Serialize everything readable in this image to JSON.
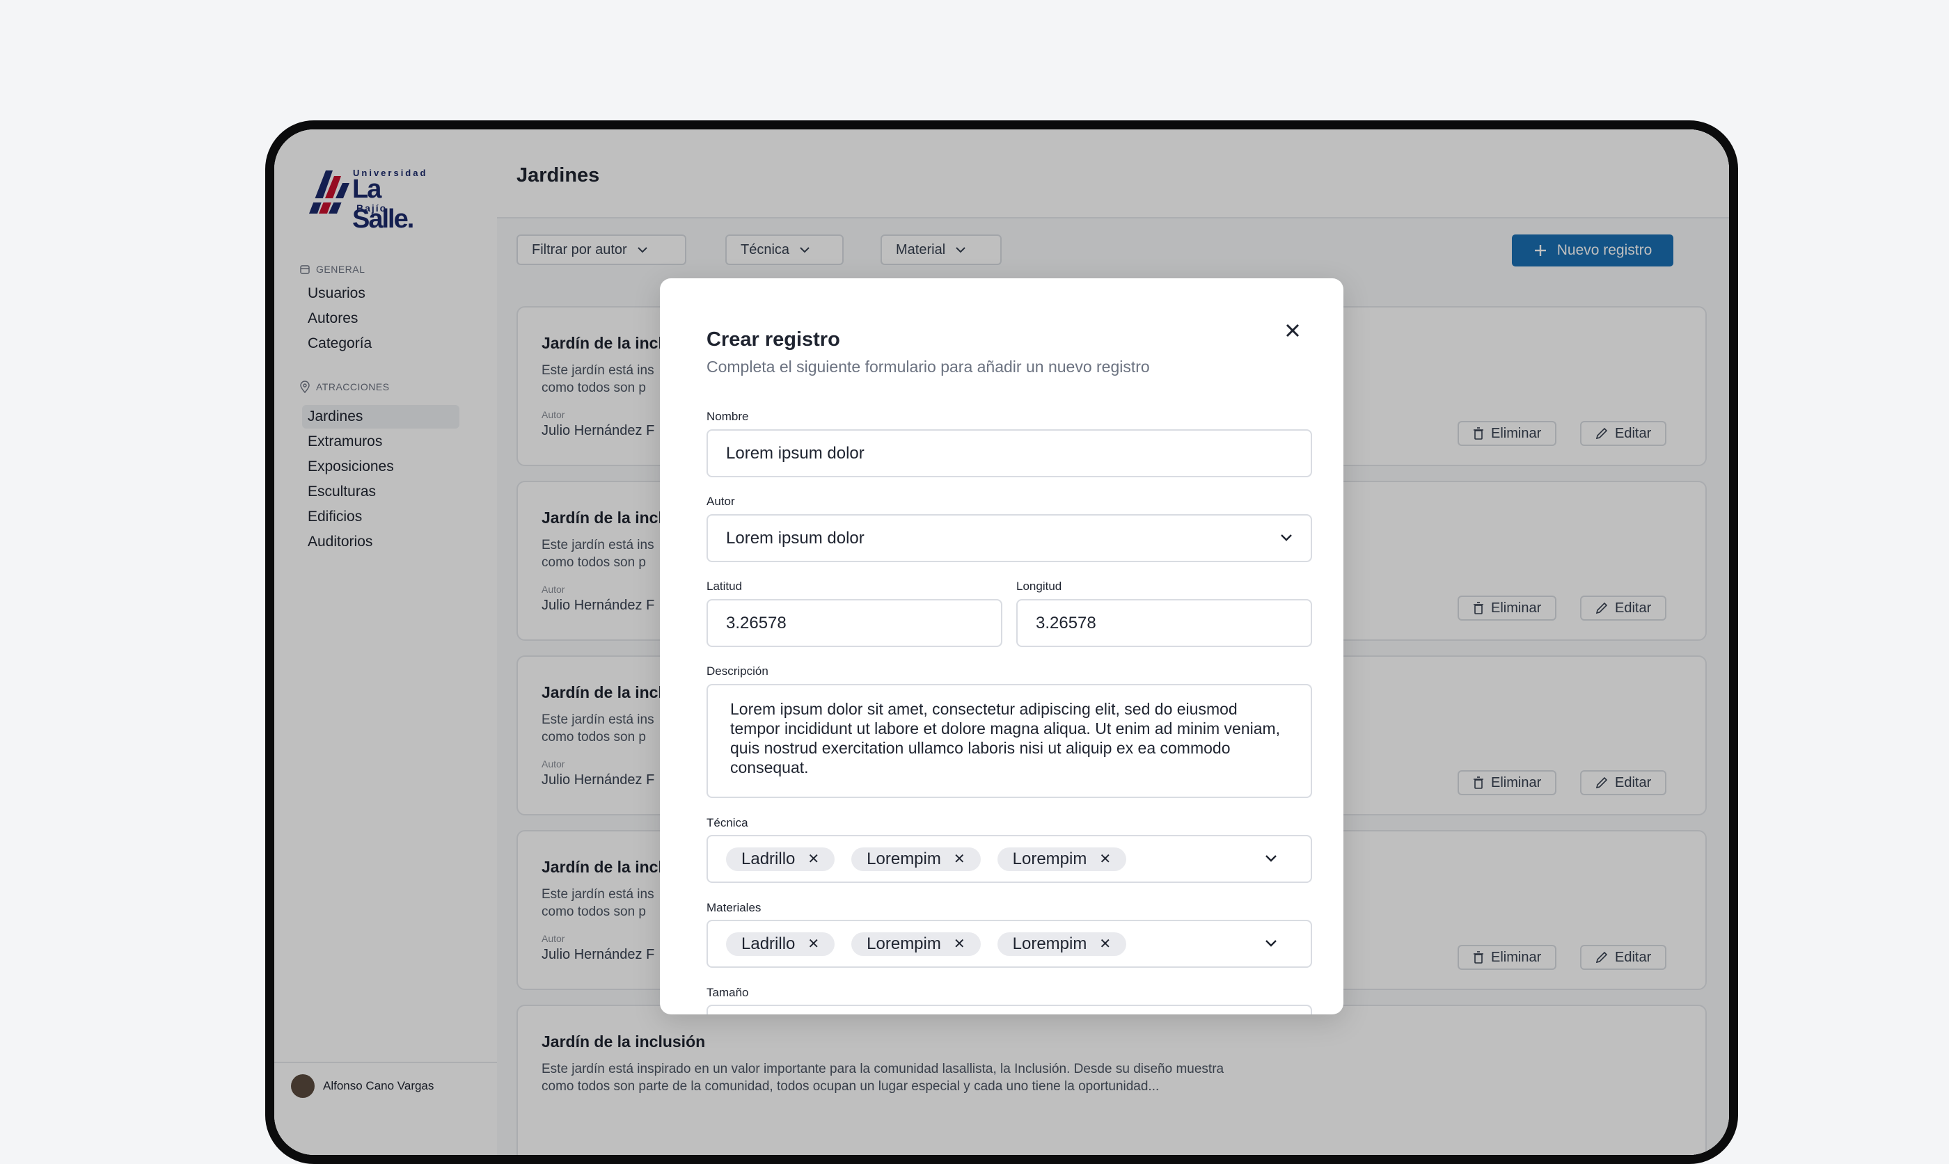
{
  "brand": {
    "top": "Universidad",
    "main": "La Salle.",
    "bottom": "Bajío",
    "colors": {
      "navy": "#1b2a6b",
      "red": "#c8102e"
    }
  },
  "sidebar": {
    "sections": [
      {
        "title": "GENERAL",
        "icon": "calendar-icon",
        "items": [
          "Usuarios",
          "Autores",
          "Categoría"
        ]
      },
      {
        "title": "ATRACCIONES",
        "icon": "map-pin-icon",
        "items": [
          "Jardines",
          "Extramuros",
          "Exposiciones",
          "Esculturas",
          "Edificios",
          "Auditorios"
        ]
      }
    ],
    "active_item": "Jardines",
    "user": {
      "name": "Alfonso Cano Vargas"
    }
  },
  "page": {
    "title": "Jardines",
    "filters": [
      {
        "label": "Filtrar por autor",
        "icon": "chevron-down-icon"
      },
      {
        "label": "Técnica",
        "icon": "chevron-down-icon"
      },
      {
        "label": "Material",
        "icon": "chevron-down-icon"
      }
    ],
    "new_button": {
      "label": "Nuevo registro",
      "icon": "plus-icon",
      "color": "#1a6fb3"
    }
  },
  "cards": [
    {
      "title": "Jardín de la incl",
      "desc_1": "Este jardín está ins",
      "desc_2": "como todos son p",
      "autor_label": "Autor",
      "autor": "Julio Hernández F",
      "delete": "Eliminar",
      "edit": "Editar"
    },
    {
      "title": "Jardín de la incl",
      "desc_1": "Este jardín está ins",
      "desc_2": "como todos son p",
      "autor_label": "Autor",
      "autor": "Julio Hernández F",
      "delete": "Eliminar",
      "edit": "Editar"
    },
    {
      "title": "Jardín de la incl",
      "desc_1": "Este jardín está ins",
      "desc_2": "como todos son p",
      "autor_label": "Autor",
      "autor": "Julio Hernández F",
      "delete": "Eliminar",
      "edit": "Editar"
    },
    {
      "title": "Jardín de la incl",
      "desc_1": "Este jardín está ins",
      "desc_2": "como todos son p",
      "autor_label": "Autor",
      "autor": "Julio Hernández F",
      "delete": "Eliminar",
      "edit": "Editar"
    },
    {
      "title": "Jardín de la inclusión",
      "desc_1": "Este jardín está inspirado en un valor importante para la comunidad lasallista, la Inclusión. Desde su diseño muestra",
      "desc_2": "como todos son parte de la comunidad, todos ocupan un lugar especial y cada uno tiene la oportunidad...",
      "autor_label": "",
      "autor": "",
      "delete": "",
      "edit": ""
    }
  ],
  "modal": {
    "title": "Crear registro",
    "subtitle": "Completa el siguiente formulario para añadir un nuevo registro",
    "close_icon": "close-icon",
    "fields": {
      "nombre": {
        "label": "Nombre",
        "value": "Lorem ipsum dolor"
      },
      "autor": {
        "label": "Autor",
        "value": "Lorem ipsum dolor"
      },
      "latitud": {
        "label": "Latitud",
        "value": "3.26578"
      },
      "longitud": {
        "label": "Longitud",
        "value": "3.26578"
      },
      "descripcion": {
        "label": "Descripción",
        "value": "Lorem ipsum dolor sit amet, consectetur adipiscing elit, sed do eiusmod tempor incididunt ut labore et dolore magna aliqua. Ut enim ad minim veniam, quis nostrud exercitation ullamco laboris nisi ut aliquip ex ea commodo consequat."
      },
      "tecnica": {
        "label": "Técnica",
        "chips": [
          "Ladrillo",
          "Lorempim",
          "Lorempim"
        ]
      },
      "materiales": {
        "label": "Materiales",
        "chips": [
          "Ladrillo",
          "Lorempim",
          "Lorempim"
        ]
      },
      "tamano": {
        "label": "Tamaño"
      }
    }
  }
}
